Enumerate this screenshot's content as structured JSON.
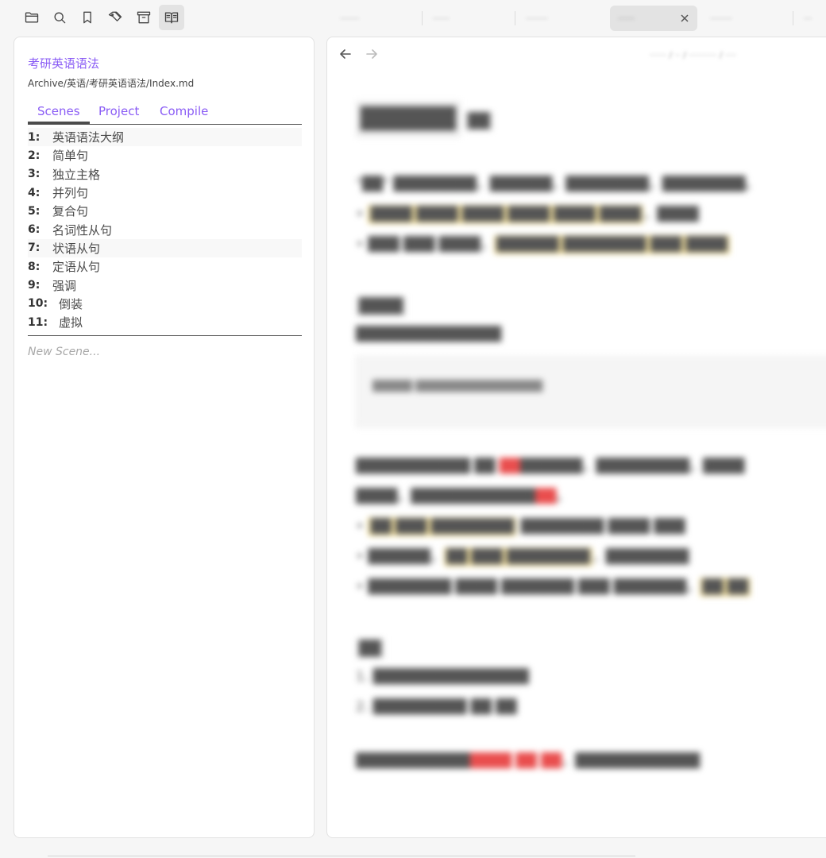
{
  "ribbon": {
    "icons": [
      "folder-icon",
      "search-icon",
      "bookmark-icon",
      "tags-icon",
      "archive-icon",
      "book-open-icon"
    ]
  },
  "tabs": [
    {
      "title": "·······",
      "active": false
    },
    {
      "title": "······",
      "active": false
    },
    {
      "title": "········",
      "active": false
    },
    {
      "title": "······",
      "active": true
    },
    {
      "title": "········",
      "active": false
    },
    {
      "title": "···",
      "active": false
    }
  ],
  "project": {
    "title": "考研英语语法",
    "path": "Archive/英语/考研英语语法/Index.md",
    "tabs": [
      "Scenes",
      "Project",
      "Compile"
    ],
    "selected_tab": "Scenes",
    "scenes": [
      {
        "num": "1:",
        "name": "英语语法大纲"
      },
      {
        "num": "2:",
        "name": "简单句"
      },
      {
        "num": "3:",
        "name": "独立主格"
      },
      {
        "num": "4:",
        "name": "并列句"
      },
      {
        "num": "5:",
        "name": "复合句"
      },
      {
        "num": "6:",
        "name": "名词性从句"
      },
      {
        "num": "7:",
        "name": "状语从句"
      },
      {
        "num": "8:",
        "name": "定语从句"
      },
      {
        "num": "9:",
        "name": "强调"
      },
      {
        "num": "10:",
        "name": "倒装"
      },
      {
        "num": "11:",
        "name": "虚拟"
      }
    ],
    "new_scene_placeholder": "New Scene..."
  },
  "editor": {
    "breadcrumb": "······ / ·· / ·········· / ····",
    "blurred": true
  }
}
